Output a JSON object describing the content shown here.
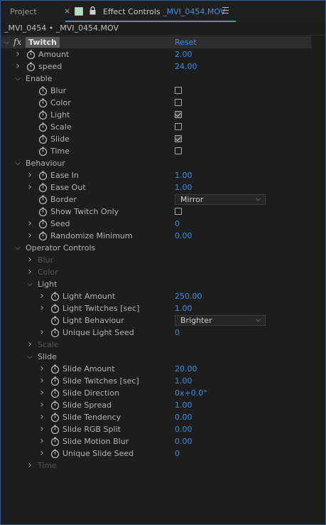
{
  "tab": {
    "project_label": "Project",
    "close_glyph": "×",
    "panel_label": "Effect Controls",
    "layer_name": "_MVI_0454.MOV",
    "menu_icon": "hamburger-menu-icon"
  },
  "breadcrumb": "_MVI_0454 • _MVI_0454.MOV",
  "effect": {
    "name": "Twitch",
    "badge": "fx",
    "reset_label": "Reset"
  },
  "rows": [
    {
      "level": 1,
      "twisty": "right",
      "stopwatch": true,
      "label": "Amount",
      "value": "2.00"
    },
    {
      "level": 1,
      "twisty": "right",
      "stopwatch": true,
      "label": "speed",
      "value": "24.00"
    },
    {
      "level": 1,
      "twisty": "down",
      "stopwatch": false,
      "label": "Enable"
    },
    {
      "level": 2,
      "twisty": "none",
      "stopwatch": true,
      "label": "Blur",
      "checkbox": false
    },
    {
      "level": 2,
      "twisty": "none",
      "stopwatch": true,
      "label": "Color",
      "checkbox": false
    },
    {
      "level": 2,
      "twisty": "none",
      "stopwatch": true,
      "label": "Light",
      "checkbox": true
    },
    {
      "level": 2,
      "twisty": "none",
      "stopwatch": true,
      "label": "Scale",
      "checkbox": false
    },
    {
      "level": 2,
      "twisty": "none",
      "stopwatch": true,
      "label": "Slide",
      "checkbox": true
    },
    {
      "level": 2,
      "twisty": "none",
      "stopwatch": true,
      "label": "Time",
      "checkbox": false
    },
    {
      "level": 1,
      "twisty": "down",
      "stopwatch": false,
      "label": "Behaviour"
    },
    {
      "level": 2,
      "twisty": "right",
      "stopwatch": true,
      "label": "Ease In",
      "value": "1.00"
    },
    {
      "level": 2,
      "twisty": "right",
      "stopwatch": true,
      "label": "Ease Out",
      "value": "1.00"
    },
    {
      "level": 2,
      "twisty": "none",
      "stopwatch": true,
      "label": "Border",
      "dropdown": "Mirror"
    },
    {
      "level": 2,
      "twisty": "none",
      "stopwatch": true,
      "label": "Show Twitch Only",
      "checkbox": false
    },
    {
      "level": 2,
      "twisty": "right",
      "stopwatch": true,
      "label": "Seed",
      "value": "0"
    },
    {
      "level": 2,
      "twisty": "right",
      "stopwatch": true,
      "label": "Randomize Minimum",
      "value": "0.00"
    },
    {
      "level": 1,
      "twisty": "down",
      "stopwatch": false,
      "label": "Operator Controls"
    },
    {
      "level": 2,
      "twisty": "right",
      "stopwatch": false,
      "label": "Blur",
      "dim": true
    },
    {
      "level": 2,
      "twisty": "right",
      "stopwatch": false,
      "label": "Color",
      "dim": true
    },
    {
      "level": 2,
      "twisty": "down",
      "stopwatch": false,
      "label": "Light"
    },
    {
      "level": 3,
      "twisty": "right",
      "stopwatch": true,
      "label": "Light Amount",
      "value": "250.00"
    },
    {
      "level": 3,
      "twisty": "right",
      "stopwatch": true,
      "label": "Light Twitches [sec]",
      "value": "1.00"
    },
    {
      "level": 3,
      "twisty": "none",
      "stopwatch": true,
      "label": "Light Behaviour",
      "dropdown": "Brighter"
    },
    {
      "level": 3,
      "twisty": "right",
      "stopwatch": true,
      "label": "Unique Light Seed",
      "value": "0"
    },
    {
      "level": 2,
      "twisty": "right",
      "stopwatch": false,
      "label": "Scale",
      "dim": true
    },
    {
      "level": 2,
      "twisty": "down",
      "stopwatch": false,
      "label": "Slide"
    },
    {
      "level": 3,
      "twisty": "right",
      "stopwatch": true,
      "label": "Slide Amount",
      "value": "20.00"
    },
    {
      "level": 3,
      "twisty": "right",
      "stopwatch": true,
      "label": "Slide Twitches [sec]",
      "value": "1.00"
    },
    {
      "level": 3,
      "twisty": "right",
      "stopwatch": true,
      "label": "Slide Direction",
      "value": "0x+0.0°"
    },
    {
      "level": 3,
      "twisty": "right",
      "stopwatch": true,
      "label": "Slide Spread",
      "value": "1.00"
    },
    {
      "level": 3,
      "twisty": "right",
      "stopwatch": true,
      "label": "Slide Tendency",
      "value": "0.00"
    },
    {
      "level": 3,
      "twisty": "right",
      "stopwatch": true,
      "label": "Slide RGB Split",
      "value": "0.00"
    },
    {
      "level": 3,
      "twisty": "right",
      "stopwatch": true,
      "label": "Slide Motion Blur",
      "value": "0.00"
    },
    {
      "level": 3,
      "twisty": "right",
      "stopwatch": true,
      "label": "Unique Slide Seed",
      "value": "0"
    },
    {
      "level": 2,
      "twisty": "right",
      "stopwatch": false,
      "label": "Time",
      "dim": true
    }
  ],
  "colors": {
    "value_blue": "#3d8ee6",
    "panel_bg": "#1d1d1d",
    "accent_border": "#3a5a8c"
  }
}
